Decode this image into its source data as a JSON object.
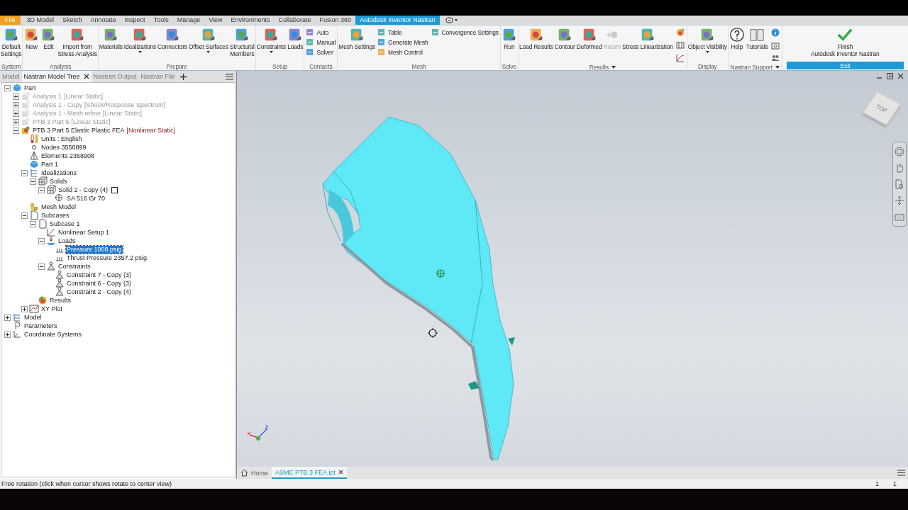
{
  "ribbon_tabs": [
    {
      "label": "File",
      "kind": "file",
      "selected": false
    },
    {
      "label": "3D Model",
      "kind": "tab",
      "selected": false
    },
    {
      "label": "Sketch",
      "kind": "tab",
      "selected": false
    },
    {
      "label": "Annotate",
      "kind": "tab",
      "selected": false
    },
    {
      "label": "Inspect",
      "kind": "tab",
      "selected": false
    },
    {
      "label": "Tools",
      "kind": "tab",
      "selected": false
    },
    {
      "label": "Manage",
      "kind": "tab",
      "selected": false
    },
    {
      "label": "View",
      "kind": "tab",
      "selected": false
    },
    {
      "label": "Environments",
      "kind": "tab",
      "selected": false
    },
    {
      "label": "Collaborate",
      "kind": "tab",
      "selected": false
    },
    {
      "label": "Fusion 360",
      "kind": "tab",
      "selected": false
    },
    {
      "label": "Autodesk Inventor Nastran",
      "kind": "tab",
      "selected": true
    }
  ],
  "ribbon_groups": [
    {
      "label": "System",
      "kind": "plain",
      "active": false,
      "items": [
        {
          "kind": "large",
          "label": "Default\nSettings",
          "disabled": false
        }
      ]
    },
    {
      "label": "Analysis",
      "kind": "plain",
      "active": false,
      "items": [
        {
          "kind": "large",
          "label": "New",
          "disabled": false
        },
        {
          "kind": "large",
          "label": "Edit",
          "disabled": false
        },
        {
          "kind": "large",
          "label": "Import from\nStress Analysis",
          "disabled": false
        }
      ]
    },
    {
      "label": "Prepare",
      "kind": "plain",
      "active": false,
      "items": [
        {
          "kind": "large",
          "label": "Materials",
          "disabled": false
        },
        {
          "kind": "large",
          "label": "Idealizations",
          "caret": true,
          "disabled": false
        },
        {
          "kind": "large",
          "label": "Connectors",
          "disabled": false
        },
        {
          "kind": "large",
          "label": "Offset Surfaces",
          "caret": true,
          "disabled": false
        },
        {
          "kind": "large",
          "label": "Structural\nMembers",
          "disabled": false
        }
      ]
    },
    {
      "label": "Setup",
      "kind": "plain",
      "active": false,
      "items": [
        {
          "kind": "large",
          "label": "Constraints",
          "caret": true,
          "disabled": false
        },
        {
          "kind": "large",
          "label": "Loads",
          "disabled": false
        }
      ]
    },
    {
      "label": "Contacts",
      "kind": "plain",
      "active": false,
      "items": [
        {
          "kind": "stack",
          "items": [
            {
              "label": "Auto"
            },
            {
              "label": "Manual"
            },
            {
              "label": "Solver"
            }
          ]
        }
      ]
    },
    {
      "label": "Mesh",
      "kind": "plain",
      "active": false,
      "items": [
        {
          "kind": "large",
          "label": "Mesh Settings",
          "disabled": false
        },
        {
          "kind": "stack",
          "items": [
            {
              "label": "Table"
            },
            {
              "label": "Generate Mesh"
            },
            {
              "label": "Mesh Control"
            }
          ]
        },
        {
          "kind": "stack",
          "items": [
            {
              "label": "Convergence Settings"
            }
          ]
        }
      ]
    },
    {
      "label": "Solve",
      "kind": "plain",
      "active": false,
      "items": [
        {
          "kind": "large",
          "label": "Run",
          "disabled": false
        }
      ]
    },
    {
      "label": "Results",
      "kind": "results",
      "caret": true,
      "active": false,
      "items": [
        {
          "kind": "large",
          "label": "Load Results",
          "disabled": false
        },
        {
          "kind": "large",
          "label": "Contour",
          "disabled": false
        },
        {
          "kind": "large",
          "label": "Deformed",
          "disabled": false
        },
        {
          "kind": "large",
          "label": "Return",
          "disabled": true
        },
        {
          "kind": "large",
          "label": "Stress Linearization",
          "disabled": false
        }
      ]
    },
    {
      "label": "Display",
      "kind": "plain",
      "active": false,
      "items": [
        {
          "kind": "large",
          "label": "Object Visibility",
          "caret": true,
          "disabled": false
        }
      ]
    },
    {
      "label": "Nastran Support",
      "kind": "support",
      "caret": true,
      "active": false,
      "items": [
        {
          "kind": "large",
          "label": "Help",
          "disabled": false
        },
        {
          "kind": "large",
          "label": "Tutorials",
          "disabled": false
        }
      ]
    },
    {
      "label": "Exit",
      "kind": "exit",
      "active": true,
      "items": [
        {
          "kind": "large",
          "label": "Finish\nAutodesk Inventor Nastran",
          "disabled": false
        }
      ]
    }
  ],
  "panel_tabs": [
    {
      "label": "Model",
      "selected": false,
      "closable": false
    },
    {
      "label": "Nastran Model Tree",
      "selected": true,
      "closable": true
    },
    {
      "label": "Nastran Output",
      "selected": false,
      "closable": false
    },
    {
      "label": "Nastran File",
      "selected": false,
      "closable": false
    }
  ],
  "tree": [
    {
      "label": "Part",
      "kind": "part",
      "expanded": true,
      "selected": false,
      "children": [
        {
          "label": "Analysis 1",
          "tag": "[Linear Static]",
          "kind": "analysis",
          "expanded": false,
          "disabled": true,
          "selected": false
        },
        {
          "label": "Analysis 1 - Copy",
          "tag": "[Shock/Response Spectrum]",
          "kind": "analysis",
          "expanded": false,
          "disabled": true,
          "selected": false
        },
        {
          "label": "Analysis 1 - Mesh refine",
          "tag": "[Linear Static]",
          "kind": "analysis",
          "expanded": false,
          "disabled": true,
          "selected": false
        },
        {
          "label": "PTB 3 Part 5",
          "tag": "[Linear Static]",
          "kind": "analysis",
          "expanded": false,
          "disabled": true,
          "selected": false
        },
        {
          "label": "PTB 3 Part 5 Elastic Plastic FEA",
          "tag": "[Nonlinear Static]",
          "kind": "analysis-active",
          "expanded": true,
          "disabled": false,
          "selected": false,
          "children": [
            {
              "label": "Units : English",
              "kind": "units",
              "selected": false
            },
            {
              "label": "Nodes 3550899",
              "kind": "nodes",
              "selected": false
            },
            {
              "label": "Elements 2368908",
              "kind": "elements",
              "selected": false
            },
            {
              "label": "Part 1",
              "kind": "part",
              "selected": false
            },
            {
              "label": "Idealizations",
              "kind": "idealizations",
              "expanded": true,
              "selected": false,
              "children": [
                {
                  "label": "Solids",
                  "kind": "solid",
                  "expanded": true,
                  "selected": false,
                  "children": [
                    {
                      "label": "Solid 2 - Copy (4)",
                      "kind": "solid",
                      "expanded": true,
                      "checked": false,
                      "selected": false,
                      "children": [
                        {
                          "label": "SA 516 Gr 70",
                          "kind": "material",
                          "selected": false
                        }
                      ]
                    }
                  ]
                }
              ]
            },
            {
              "label": "Mesh Model",
              "kind": "mesh",
              "selected": false
            },
            {
              "label": "Subcases",
              "kind": "subcase",
              "expanded": true,
              "selected": false,
              "children": [
                {
                  "label": "Subcase 1",
                  "kind": "subcase",
                  "expanded": true,
                  "selected": false,
                  "children": [
                    {
                      "label": "Nonlinear Setup 1",
                      "kind": "setup",
                      "selected": false
                    },
                    {
                      "label": "Loads",
                      "kind": "loads",
                      "expanded": true,
                      "selected": false,
                      "children": [
                        {
                          "label": "Pressure 1008 psig",
                          "kind": "pressure",
                          "selected": true
                        },
                        {
                          "label": "Thrust Pressure 2357.2 psig",
                          "kind": "pressure",
                          "selected": false
                        }
                      ]
                    },
                    {
                      "label": "Constraints",
                      "kind": "constraint",
                      "expanded": true,
                      "selected": false,
                      "children": [
                        {
                          "label": "Constraint 7 - Copy (3)",
                          "kind": "constraint",
                          "selected": false
                        },
                        {
                          "label": "Constraint 6 - Copy (3)",
                          "kind": "constraint",
                          "selected": false
                        },
                        {
                          "label": "Constraint 2 - Copy (4)",
                          "kind": "constraint",
                          "selected": false
                        }
                      ]
                    }
                  ]
                },
                {
                  "label": "Results",
                  "kind": "results",
                  "selected": false
                }
              ]
            },
            {
              "label": "XY Plot",
              "kind": "plot",
              "expanded": false,
              "selected": false
            }
          ]
        }
      ]
    },
    {
      "label": "Model",
      "kind": "idealizations",
      "expanded": false,
      "selected": false
    },
    {
      "label": "Parameters",
      "kind": "param",
      "selected": false
    },
    {
      "label": "Coordinate Systems",
      "kind": "coords",
      "expanded": false,
      "selected": false
    }
  ],
  "viewcube": {
    "label": "TOP"
  },
  "document_tabs": [
    {
      "label": "Home",
      "kind": "home",
      "selected": false
    },
    {
      "label": "ASME PTB 3 FEA.ipt",
      "kind": "doc",
      "selected": true
    }
  ],
  "status_bar": {
    "message": "Free rotation (click when cursor shows rotate to center view)",
    "counts": [
      "1",
      "1"
    ]
  }
}
